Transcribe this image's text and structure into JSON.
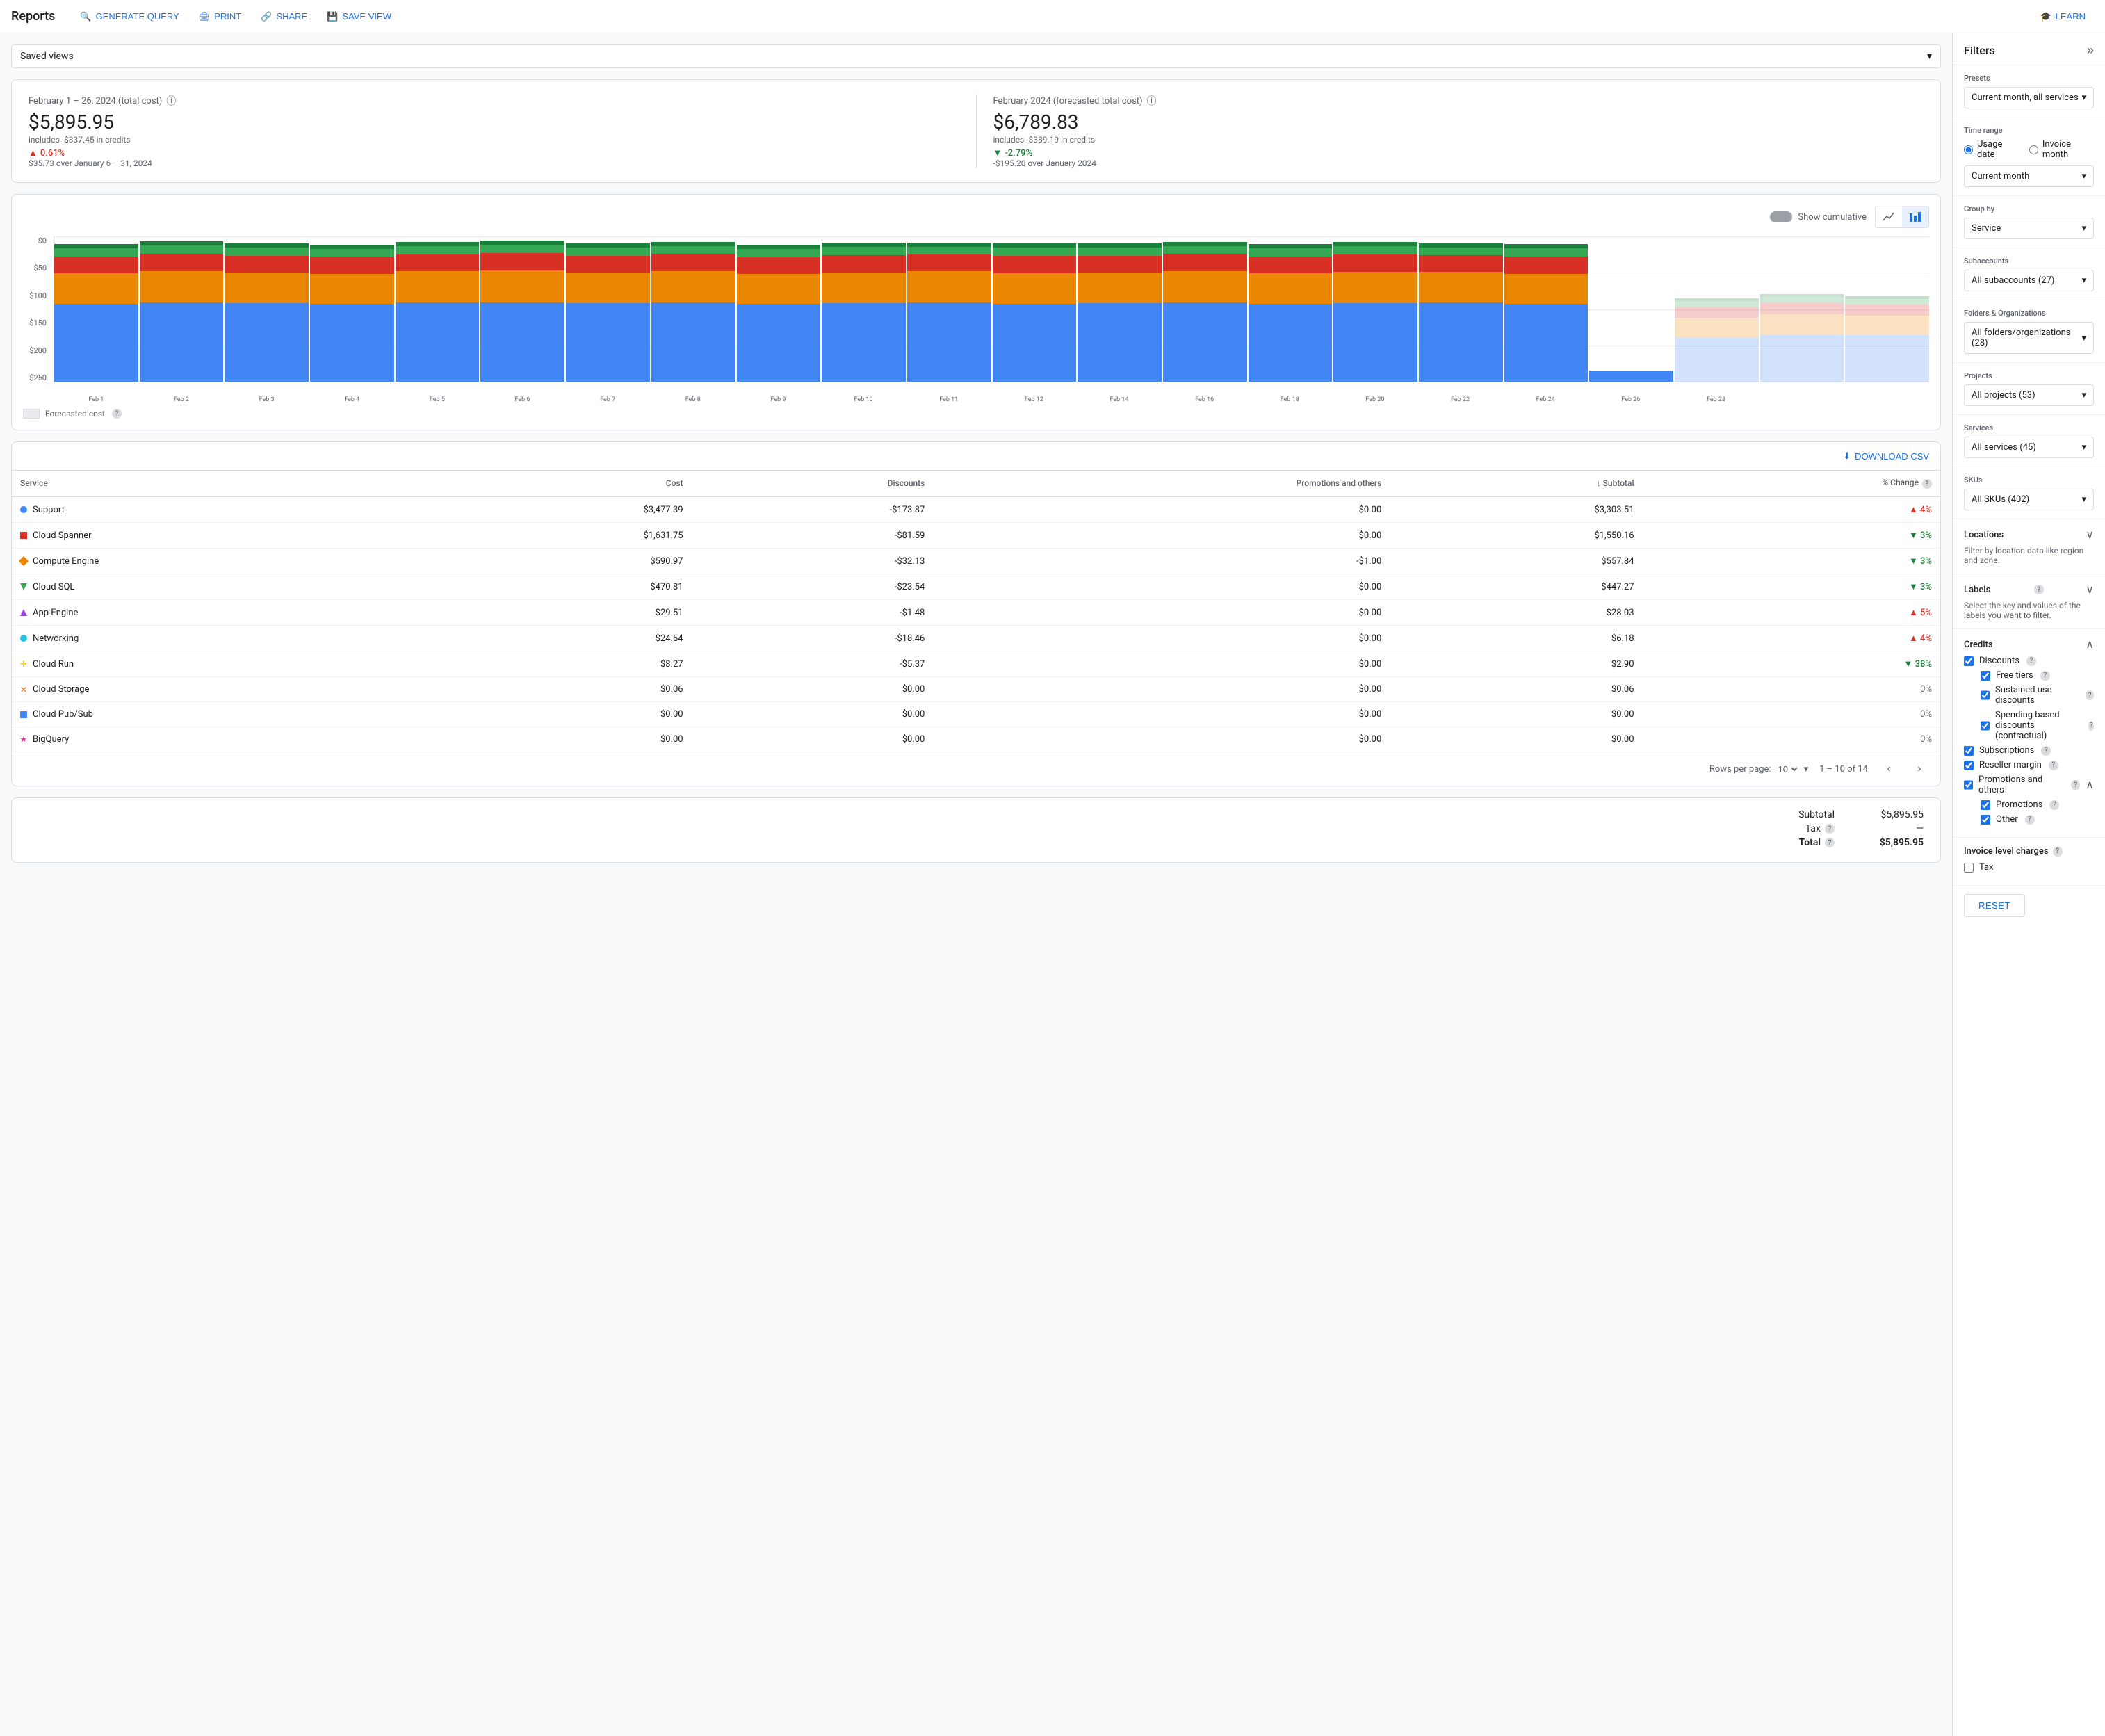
{
  "app": {
    "title": "Reports"
  },
  "topNav": {
    "generateQuery": "GENERATE QUERY",
    "print": "PRINT",
    "share": "SHARE",
    "saveView": "SAVE VIEW",
    "learn": "LEARN"
  },
  "savedViews": {
    "label": "Saved views"
  },
  "stats": {
    "current": {
      "label": "February 1 – 26, 2024 (total cost)",
      "value": "$5,895.95",
      "sub": "includes -$337.45 in credits",
      "changePercent": "0.61%",
      "changeDir": "up",
      "changeDetail": "$35.73 over January 6 – 31, 2024"
    },
    "forecast": {
      "label": "February 2024 (forecasted total cost)",
      "value": "$6,789.83",
      "sub": "includes -$389.19 in credits",
      "changePercent": "-2.79%",
      "changeDir": "down",
      "changeDetail": "-$195.20 over January 2024"
    }
  },
  "chart": {
    "showCumulative": "Show cumulative",
    "yLabels": [
      "$0",
      "$50",
      "$100",
      "$150",
      "$200",
      "$250"
    ],
    "xLabels": [
      "Feb 1",
      "Feb 2",
      "Feb 3",
      "Feb 4",
      "Feb 5",
      "Feb 6",
      "Feb 7",
      "Feb 8",
      "Feb 9",
      "Feb 10",
      "Feb 11",
      "Feb 12",
      "Feb 14",
      "Feb 16",
      "Feb 18",
      "Feb 20",
      "Feb 22",
      "Feb 24",
      "Feb 26",
      "Feb 28"
    ],
    "colors": {
      "blue": "#4285f4",
      "orange": "#ea8600",
      "red": "#d93025",
      "green": "#188038",
      "darkGreen": "#34a853",
      "gray": "#e8eaed"
    },
    "forecastLabel": "Forecasted cost"
  },
  "table": {
    "downloadLabel": "DOWNLOAD CSV",
    "columns": [
      "Service",
      "Cost",
      "Discounts",
      "Promotions and others",
      "↓ Subtotal",
      "% Change"
    ],
    "rows": [
      {
        "service": "Support",
        "color": "#4285f4",
        "shape": "circle",
        "cost": "$3,477.39",
        "discounts": "-$173.87",
        "promotions": "$0.00",
        "subtotal": "$3,303.51",
        "change": "4%",
        "changeDir": "up"
      },
      {
        "service": "Cloud Spanner",
        "color": "#d93025",
        "shape": "square",
        "cost": "$1,631.75",
        "discounts": "-$81.59",
        "promotions": "$0.00",
        "subtotal": "$1,550.16",
        "change": "3%",
        "changeDir": "down"
      },
      {
        "service": "Compute Engine",
        "color": "#ea8600",
        "shape": "diamond",
        "cost": "$590.97",
        "discounts": "-$32.13",
        "promotions": "-$1.00",
        "subtotal": "$557.84",
        "change": "3%",
        "changeDir": "down"
      },
      {
        "service": "Cloud SQL",
        "color": "#34a853",
        "shape": "triangle-down",
        "cost": "$470.81",
        "discounts": "-$23.54",
        "promotions": "$0.00",
        "subtotal": "$447.27",
        "change": "3%",
        "changeDir": "down"
      },
      {
        "service": "App Engine",
        "color": "#a142f4",
        "shape": "triangle-up",
        "cost": "$29.51",
        "discounts": "-$1.48",
        "promotions": "$0.00",
        "subtotal": "$28.03",
        "change": "5%",
        "changeDir": "up"
      },
      {
        "service": "Networking",
        "color": "#24c1e0",
        "shape": "circle",
        "cost": "$24.64",
        "discounts": "-$18.46",
        "promotions": "$0.00",
        "subtotal": "$6.18",
        "change": "4%",
        "changeDir": "up"
      },
      {
        "service": "Cloud Run",
        "color": "#f4b400",
        "shape": "cross",
        "cost": "$8.27",
        "discounts": "-$5.37",
        "promotions": "$0.00",
        "subtotal": "$2.90",
        "change": "38%",
        "changeDir": "down"
      },
      {
        "service": "Cloud Storage",
        "color": "#e8710a",
        "shape": "x",
        "cost": "$0.06",
        "discounts": "$0.00",
        "promotions": "$0.00",
        "subtotal": "$0.06",
        "change": "0%",
        "changeDir": "neutral"
      },
      {
        "service": "Cloud Pub/Sub",
        "color": "#4285f4",
        "shape": "square-blue",
        "cost": "$0.00",
        "discounts": "$0.00",
        "promotions": "$0.00",
        "subtotal": "$0.00",
        "change": "0%",
        "changeDir": "neutral"
      },
      {
        "service": "BigQuery",
        "color": "#e52592",
        "shape": "star",
        "cost": "$0.00",
        "discounts": "$0.00",
        "promotions": "$0.00",
        "subtotal": "$0.00",
        "change": "0%",
        "changeDir": "neutral"
      }
    ],
    "pagination": {
      "rowsPerPage": "10",
      "rowsPerPageLabel": "Rows per page:",
      "pageInfo": "1 – 10 of 14"
    },
    "totals": {
      "subtotalLabel": "Subtotal",
      "subtotalValue": "$5,895.95",
      "taxLabel": "Tax",
      "taxValue": "—",
      "totalLabel": "Total",
      "totalValue": "$5,895.95"
    }
  },
  "filters": {
    "title": "Filters",
    "presets": {
      "label": "Presets",
      "value": "Current month, all services"
    },
    "timeRange": {
      "label": "Time range",
      "usageDateLabel": "Usage date",
      "invoiceMonthLabel": "Invoice month",
      "currentMonth": "Current month"
    },
    "groupBy": {
      "label": "Group by",
      "value": "Service"
    },
    "subaccounts": {
      "label": "Subaccounts",
      "value": "All subaccounts (27)"
    },
    "foldersOrgs": {
      "label": "Folders & Organizations",
      "value": "All folders/organizations (28)"
    },
    "projects": {
      "label": "Projects",
      "value": "All projects (53)"
    },
    "services": {
      "label": "Services",
      "value": "All services (45)"
    },
    "skus": {
      "label": "SKUs",
      "value": "All SKUs (402)"
    },
    "locations": {
      "label": "Locations",
      "description": "Filter by location data like region and zone."
    },
    "labels": {
      "label": "Labels",
      "description": "Select the key and values of the labels you want to filter."
    },
    "credits": {
      "label": "Credits",
      "discountsLabel": "Discounts",
      "freeTiersLabel": "Free tiers",
      "sustainedUseLabel": "Sustained use discounts",
      "spendingBasedLabel": "Spending based discounts (contractual)",
      "subscriptionsLabel": "Subscriptions",
      "resellerMarginLabel": "Reseller margin",
      "promotionsAndOthersLabel": "Promotions and others",
      "promotionsLabel": "Promotions",
      "otherLabel": "Other"
    },
    "invoiceLevelCharges": {
      "label": "Invoice level charges",
      "taxLabel": "Tax"
    },
    "resetLabel": "RESET"
  }
}
